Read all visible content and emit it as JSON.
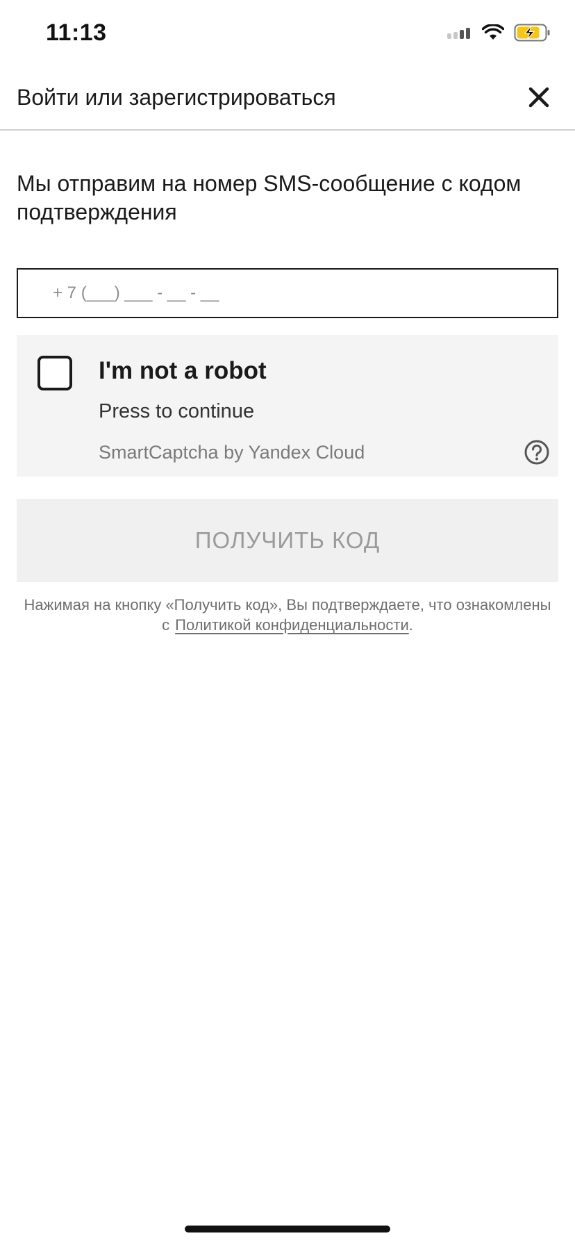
{
  "status_bar": {
    "time": "11:13",
    "icons": [
      "signal-icon",
      "wifi-icon",
      "battery-charging-icon"
    ],
    "battery_color": "#f5c518"
  },
  "header": {
    "title": "Войти или зарегистрироваться",
    "close_icon": "close-icon"
  },
  "description": "Мы отправим на номер SMS-сообщение с кодом подтверждения",
  "phone_input": {
    "value": "",
    "placeholder": "+ 7 (___) ___ - __ - __"
  },
  "captcha": {
    "title": "I'm not a robot",
    "subtitle": "Press to continue",
    "brand": "SmartCaptcha by Yandex Cloud",
    "checked": false,
    "help_icon": "question-circle-icon"
  },
  "get_code_button": {
    "label": "ПОЛУЧИТЬ КОД",
    "enabled": false
  },
  "consent": {
    "text": "Нажимая на кнопку «Получить код», Вы подтверждаете, что ознакомлены с",
    "link": "Политикой конфиденциальности",
    "suffix": "."
  },
  "colors": {
    "text": "#1a1a1a",
    "muted": "#7a7a7a",
    "captcha_bg": "#f4f4f4",
    "button_bg": "#f0f0f0",
    "button_text": "#9a9a9a"
  }
}
